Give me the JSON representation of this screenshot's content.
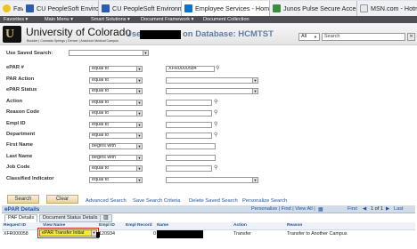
{
  "browser": {
    "tabs": [
      {
        "title": "Favorites",
        "icon": "star-icon"
      },
      {
        "title": "CU PeopleSoft Environme...",
        "icon": "peoplesoft-icon"
      },
      {
        "title": "CU PeopleSoft Environme...",
        "icon": "peoplesoft-icon"
      },
      {
        "title": "Employee Services - Home",
        "icon": "sharepoint-icon"
      },
      {
        "title": "Junos Pulse Secure Access ...",
        "icon": "junos-icon"
      },
      {
        "title": "MSN.com - Hotmai",
        "icon": "msn-icon"
      }
    ]
  },
  "menubar": {
    "favorites": "Favorites ▾",
    "main_menu": "Main Menu ▾",
    "smart_solutions": "Smart Solutions ▾",
    "document_framework": "Document Framework ▾",
    "document_collection": "Document Collection"
  },
  "header": {
    "logo_letter": "U",
    "university": "University of Colorado",
    "campuses": "Boulder | Colorado Springs | Denver | Anschutz Medical Campus",
    "user_prefix": "User",
    "database_text": "on Database: HCMTST",
    "search_scope": "All",
    "search_placeholder": "Search",
    "go": "»"
  },
  "form": {
    "saved_search_label": "Use Saved Search:",
    "fields": [
      {
        "label": "ePAR #",
        "operator": "equal to",
        "value": "XFR0000584",
        "lookup": true
      },
      {
        "label": "PAR Action",
        "operator": "equal to",
        "value": "",
        "dropdown": true
      },
      {
        "label": "ePAR Status",
        "operator": "equal to",
        "value": "",
        "dropdown": true
      },
      {
        "label": "Action",
        "operator": "equal to",
        "value": "",
        "lookup": true
      },
      {
        "label": "Reason Code",
        "operator": "equal to",
        "value": "",
        "lookup": true
      },
      {
        "label": "Empl ID",
        "operator": "equal to",
        "value": "",
        "lookup": true
      },
      {
        "label": "Department",
        "operator": "equal to",
        "value": "",
        "lookup": true
      },
      {
        "label": "First Name",
        "operator": "begins with",
        "value": ""
      },
      {
        "label": "Last Name",
        "operator": "begins with",
        "value": ""
      },
      {
        "label": "Job Code",
        "operator": "equal to",
        "value": "",
        "lookup": true
      },
      {
        "label": "Classified Indicator",
        "operator": "equal to",
        "value": "",
        "dropdown": true
      }
    ]
  },
  "actions": {
    "search": "Search",
    "clear": "Clear",
    "advanced_search": "Advanced Search",
    "save_search_criteria": "Save Search Criteria",
    "delete_saved_search": "Delete Saved Search",
    "personalize_search": "Personalize Search"
  },
  "grid": {
    "title": "ePAR Details",
    "toolbar": "Personalize | Find | View All |",
    "pager_first": "First",
    "pager_range": "1 of 1",
    "pager_last": "Last",
    "tabs": [
      "PAF Details",
      "Document Status Details"
    ],
    "columns": [
      "Request ID",
      "View Name",
      "Empl ID",
      "Empl Record",
      "Name",
      "Action",
      "Reason"
    ],
    "row": {
      "request_id": "XFR000058",
      "view_name": "ePAR Transfer Initiat",
      "empl_id": "120934",
      "empl_record": "0",
      "name": "",
      "action": "Transfer",
      "reason": "Transfer to Another Campus"
    }
  }
}
